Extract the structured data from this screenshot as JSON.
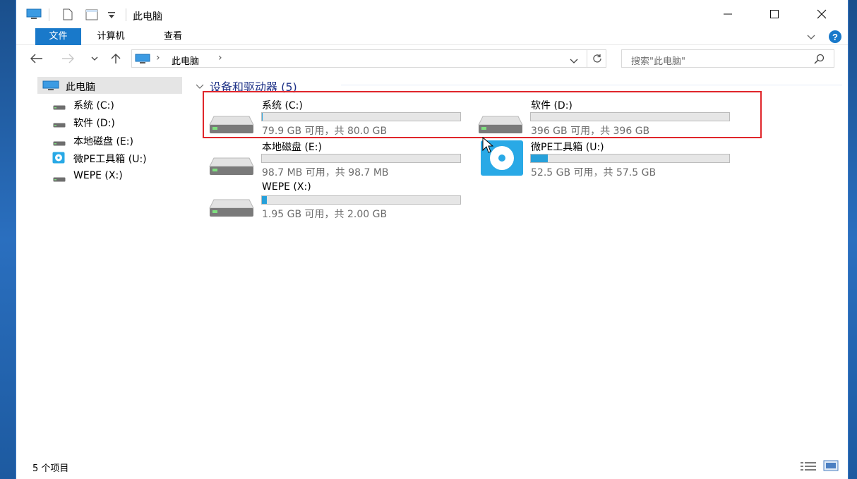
{
  "window": {
    "title": "此电脑"
  },
  "ribbon": {
    "tabs": [
      "文件",
      "计算机",
      "查看"
    ]
  },
  "address": {
    "breadcrumb": "此电脑",
    "separator": "›",
    "end_chevron": "›"
  },
  "search": {
    "placeholder": "搜索\"此电脑\""
  },
  "sidebar": {
    "items": [
      {
        "label": "此电脑",
        "icon": "pc-icon"
      },
      {
        "label": "系统 (C:)",
        "icon": "drive-icon"
      },
      {
        "label": "软件 (D:)",
        "icon": "drive-icon"
      },
      {
        "label": "本地磁盘 (E:)",
        "icon": "drive-icon"
      },
      {
        "label": "微PE工具箱 (U:)",
        "icon": "cd-icon"
      },
      {
        "label": "WEPE (X:)",
        "icon": "drive-icon"
      }
    ]
  },
  "main": {
    "group_title": "设备和驱动器 (5)",
    "drives": [
      {
        "name": "系统 (C:)",
        "capacity": "79.9 GB 可用，共 80.0 GB",
        "used_fraction": 0.001,
        "icon": "drive-icon"
      },
      {
        "name": "软件 (D:)",
        "capacity": "396 GB 可用，共 396 GB",
        "used_fraction": 0.0,
        "icon": "drive-icon"
      },
      {
        "name": "本地磁盘 (E:)",
        "capacity": "98.7 MB 可用，共 98.7 MB",
        "used_fraction": 0.0,
        "icon": "drive-icon"
      },
      {
        "name": "微PE工具箱 (U:)",
        "capacity": "52.5 GB 可用，共 57.5 GB",
        "used_fraction": 0.087,
        "icon": "cd-icon"
      },
      {
        "name": "WEPE (X:)",
        "capacity": "1.95 GB 可用，共 2.00 GB",
        "used_fraction": 0.025,
        "icon": "drive-icon"
      }
    ]
  },
  "statusbar": {
    "item_count": "5 个项目"
  },
  "colors": {
    "accent": "#1979ca",
    "bar_fill": "#26a0da",
    "highlight": "#e0262b",
    "group_title": "#1e3287"
  }
}
